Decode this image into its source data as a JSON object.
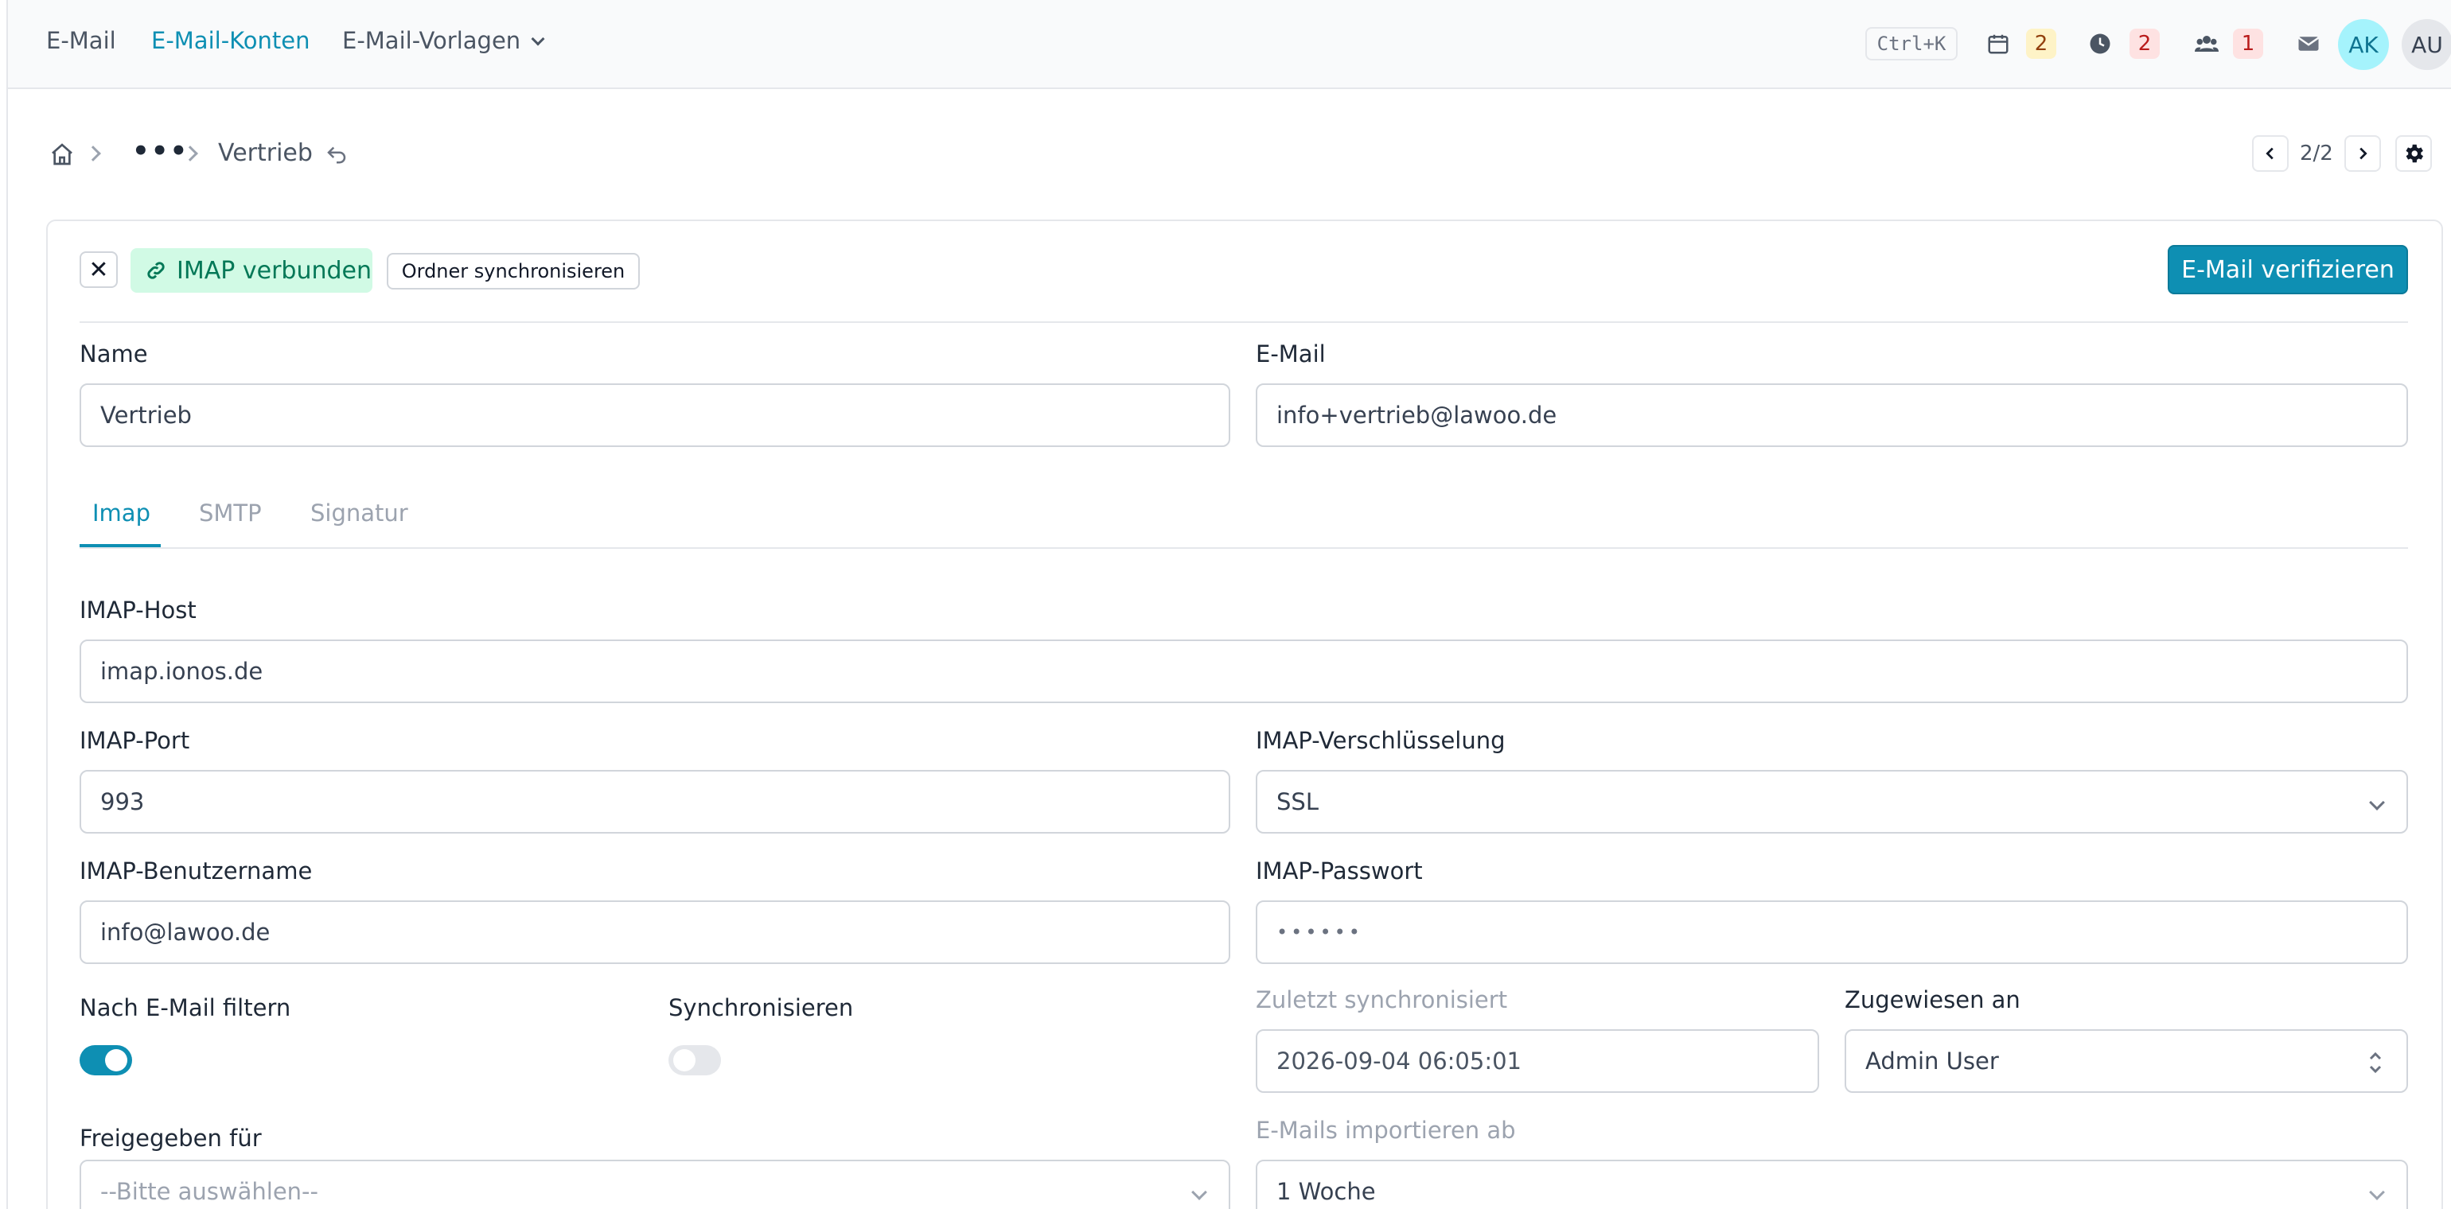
{
  "nav": {
    "email": "E-Mail",
    "accounts": "E-Mail-Konten",
    "templates": "E-Mail-Vorlagen",
    "shortcut": "Ctrl+K",
    "badges": {
      "calendar": "2",
      "clock": "2",
      "users": "1"
    },
    "avatars": [
      "AK",
      "AU"
    ]
  },
  "breadcrumb": {
    "current": "Vertrieb",
    "pager": "2/2"
  },
  "toolbar": {
    "status": "IMAP verbunden",
    "sync_folders": "Ordner synchronisieren",
    "verify": "E-Mail verifizieren"
  },
  "form": {
    "name_label": "Name",
    "name_value": "Vertrieb",
    "email_label": "E-Mail",
    "email_value": "info+vertrieb@lawoo.de",
    "tabs": [
      "Imap",
      "SMTP",
      "Signatur"
    ],
    "imap_host_label": "IMAP-Host",
    "imap_host_value": "imap.ionos.de",
    "imap_port_label": "IMAP-Port",
    "imap_port_value": "993",
    "imap_enc_label": "IMAP-Verschlüsselung",
    "imap_enc_value": "SSL",
    "imap_user_label": "IMAP-Benutzername",
    "imap_user_value": "info@lawoo.de",
    "imap_pass_label": "IMAP-Passwort",
    "imap_pass_value": "••••••",
    "filter_label": "Nach E-Mail filtern",
    "filter_on": true,
    "sync_label": "Synchronisieren",
    "sync_on": false,
    "last_sync_label": "Zuletzt synchronisiert",
    "last_sync_value": "2026-09-04 06:05:01",
    "assigned_label": "Zugewiesen an",
    "assigned_value": "Admin User",
    "shared_label": "Freigegeben für",
    "shared_placeholder": "--Bitte auswählen--",
    "import_label": "E-Mails importieren ab",
    "import_value": "1 Woche"
  },
  "colors": {
    "accent": "#0e8fb3",
    "success_bg": "#d1fae5",
    "success_text": "#047857"
  }
}
